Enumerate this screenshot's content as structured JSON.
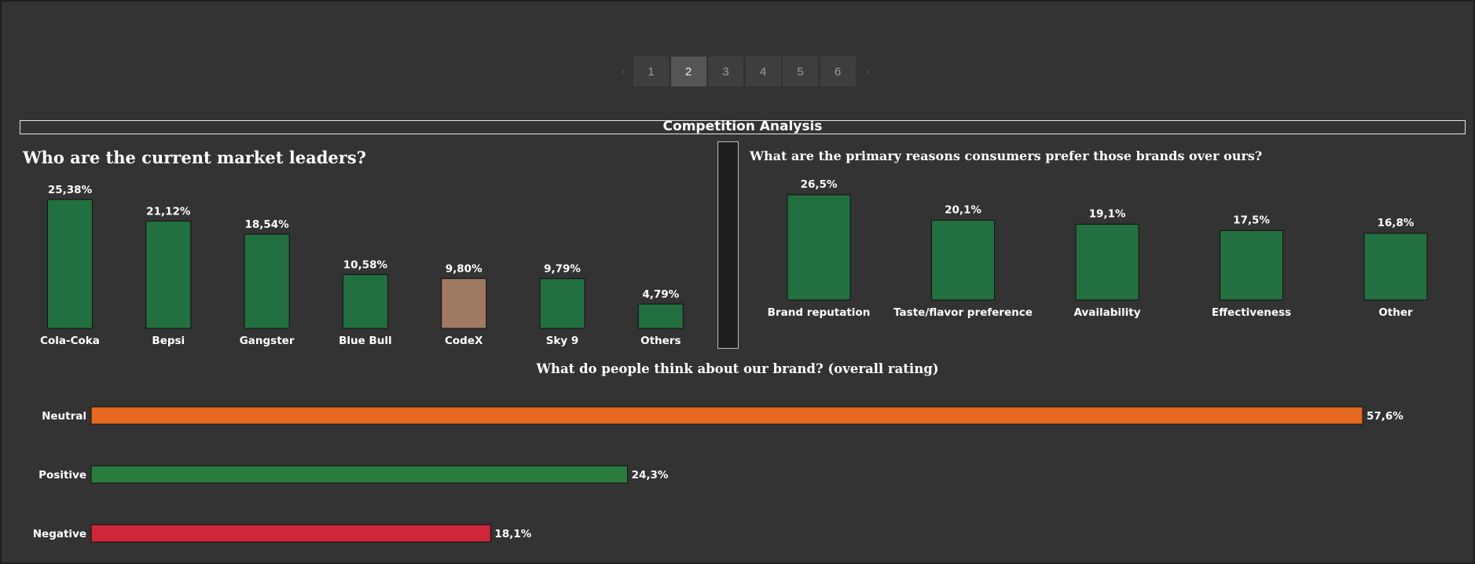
{
  "pagination": {
    "pages": [
      "1",
      "2",
      "3",
      "4",
      "5",
      "6"
    ],
    "active_index": 1,
    "prev_icon": "chevron-left-icon",
    "next_icon": "chevron-right-icon"
  },
  "dashboard_title": "Competition Analysis",
  "colors": {
    "green": "#227040",
    "brown": "#a07a62",
    "orange": "#e5691f",
    "positive_green": "#2a7a3e",
    "red": "#d0263a"
  },
  "chart_data": [
    {
      "type": "bar",
      "title": "Who are the current market leaders?",
      "categories": [
        "Cola-Coka",
        "Bepsi",
        "Gangster",
        "Blue Bull",
        "CodeX",
        "Sky 9",
        "Others"
      ],
      "values": [
        25.38,
        21.12,
        18.54,
        10.58,
        9.8,
        9.79,
        4.79
      ],
      "labels": [
        "25,38%",
        "21,12%",
        "18,54%",
        "10,58%",
        "9,80%",
        "9,79%",
        "4,79%"
      ],
      "highlight_category": "CodeX",
      "ylim": [
        0,
        25.38
      ]
    },
    {
      "type": "bar",
      "title": "What are the primary reasons consumers prefer those brands over ours?",
      "categories": [
        "Brand reputation",
        "Taste/flavor preference",
        "Availability",
        "Effectiveness",
        "Other"
      ],
      "values": [
        26.5,
        20.1,
        19.1,
        17.5,
        16.8
      ],
      "labels": [
        "26,5%",
        "20,1%",
        "19,1%",
        "17,5%",
        "16,8%"
      ],
      "ylim": [
        0,
        26.5
      ]
    },
    {
      "type": "bar",
      "orientation": "horizontal",
      "title": "What do people think about our brand? (overall rating)",
      "categories": [
        "Neutral",
        "Positive",
        "Negative"
      ],
      "values": [
        57.6,
        24.3,
        18.1
      ],
      "labels": [
        "57,6%",
        "24,3%",
        "18,1%"
      ],
      "xlim": [
        0,
        57.6
      ]
    }
  ]
}
